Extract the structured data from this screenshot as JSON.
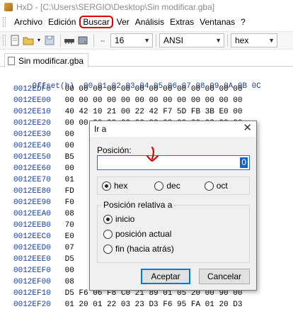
{
  "window": {
    "title": "HxD - [C:\\Users\\SERGIO\\Desktop\\Sin modificar.gba]"
  },
  "menu": [
    "Archivo",
    "Edición",
    "Buscar",
    "Ver",
    "Análisis",
    "Extras",
    "Ventanas",
    "?"
  ],
  "toolbar": {
    "bytes_per_row": "16",
    "charset": "ANSI",
    "offset_base": "hex"
  },
  "tab": {
    "label": "Sin modificar.gba"
  },
  "hex": {
    "header_offset": "Offset(h)",
    "header_bytes": "00 01 02 03 04 05 06 07 08 09 0A 0B 0C",
    "rows": [
      {
        "offset": "0012EDF0",
        "bytes": "00 00 00 00 00 00 00 00 00 00 00 00 00"
      },
      {
        "offset": "0012EE00",
        "bytes": "00 00 00 00 00 00 00 00 00 00 00 00 00"
      },
      {
        "offset": "0012EE10",
        "bytes": "40 42 10 21 00 22 42 F7 5D FB 3B E0 00"
      },
      {
        "offset": "0012EE20",
        "bytes": "00 00 00 00 00 00 00 00 00 00 02 90 00"
      },
      {
        "offset": "0012EE30",
        "bytes": "00                                   "
      },
      {
        "offset": "0012EE40",
        "bytes": "00                              FD 00"
      },
      {
        "offset": "0012EE50",
        "bytes": "B5                              F6 4B"
      },
      {
        "offset": "0012EE60",
        "bytes": "00                              00 00"
      },
      {
        "offset": "0012EE70",
        "bytes": "01                              70 11"
      },
      {
        "offset": "0012EE80",
        "bytes": "FD                              03 3D"
      },
      {
        "offset": "0012EE90",
        "bytes": "F0                              7E 00"
      },
      {
        "offset": "0012EEA0",
        "bytes": "08                              00 00"
      },
      {
        "offset": "0012EEB0",
        "bytes": "70                              F0 5F"
      },
      {
        "offset": "0012EEC0",
        "bytes": "E0                              8A 80"
      },
      {
        "offset": "0012EED0",
        "bytes": "07                              80 00"
      },
      {
        "offset": "0012EEE0",
        "bytes": "D5                              F6 B7"
      },
      {
        "offset": "0012EEF0",
        "bytes": "00                              7F 00"
      },
      {
        "offset": "0012EF00",
        "bytes": "08                              00 00"
      },
      {
        "offset": "0012EF10",
        "bytes": "D5 F6 06 F8 C0 21 89 01 05 20 00 90 00"
      },
      {
        "offset": "0012EF20",
        "bytes": "01 20 01 22 03 23 D3 F6 95 FA 01 20 D3"
      }
    ]
  },
  "dialog": {
    "title": "Ir a",
    "position_label": "Posición:",
    "position_value": "0",
    "base_options": [
      "hex",
      "dec",
      "oct"
    ],
    "base_selected": "hex",
    "relative_legend": "Posición relativa a",
    "relative_options": [
      "inicio",
      "posición actual",
      "fin (hacia atrás)"
    ],
    "relative_selected": "inicio",
    "accept_label": "Aceptar",
    "cancel_label": "Cancelar"
  },
  "colors": {
    "offset_blue": "#1a3e9a",
    "annotation_red": "#e00000",
    "focus_blue": "#0078d7"
  }
}
